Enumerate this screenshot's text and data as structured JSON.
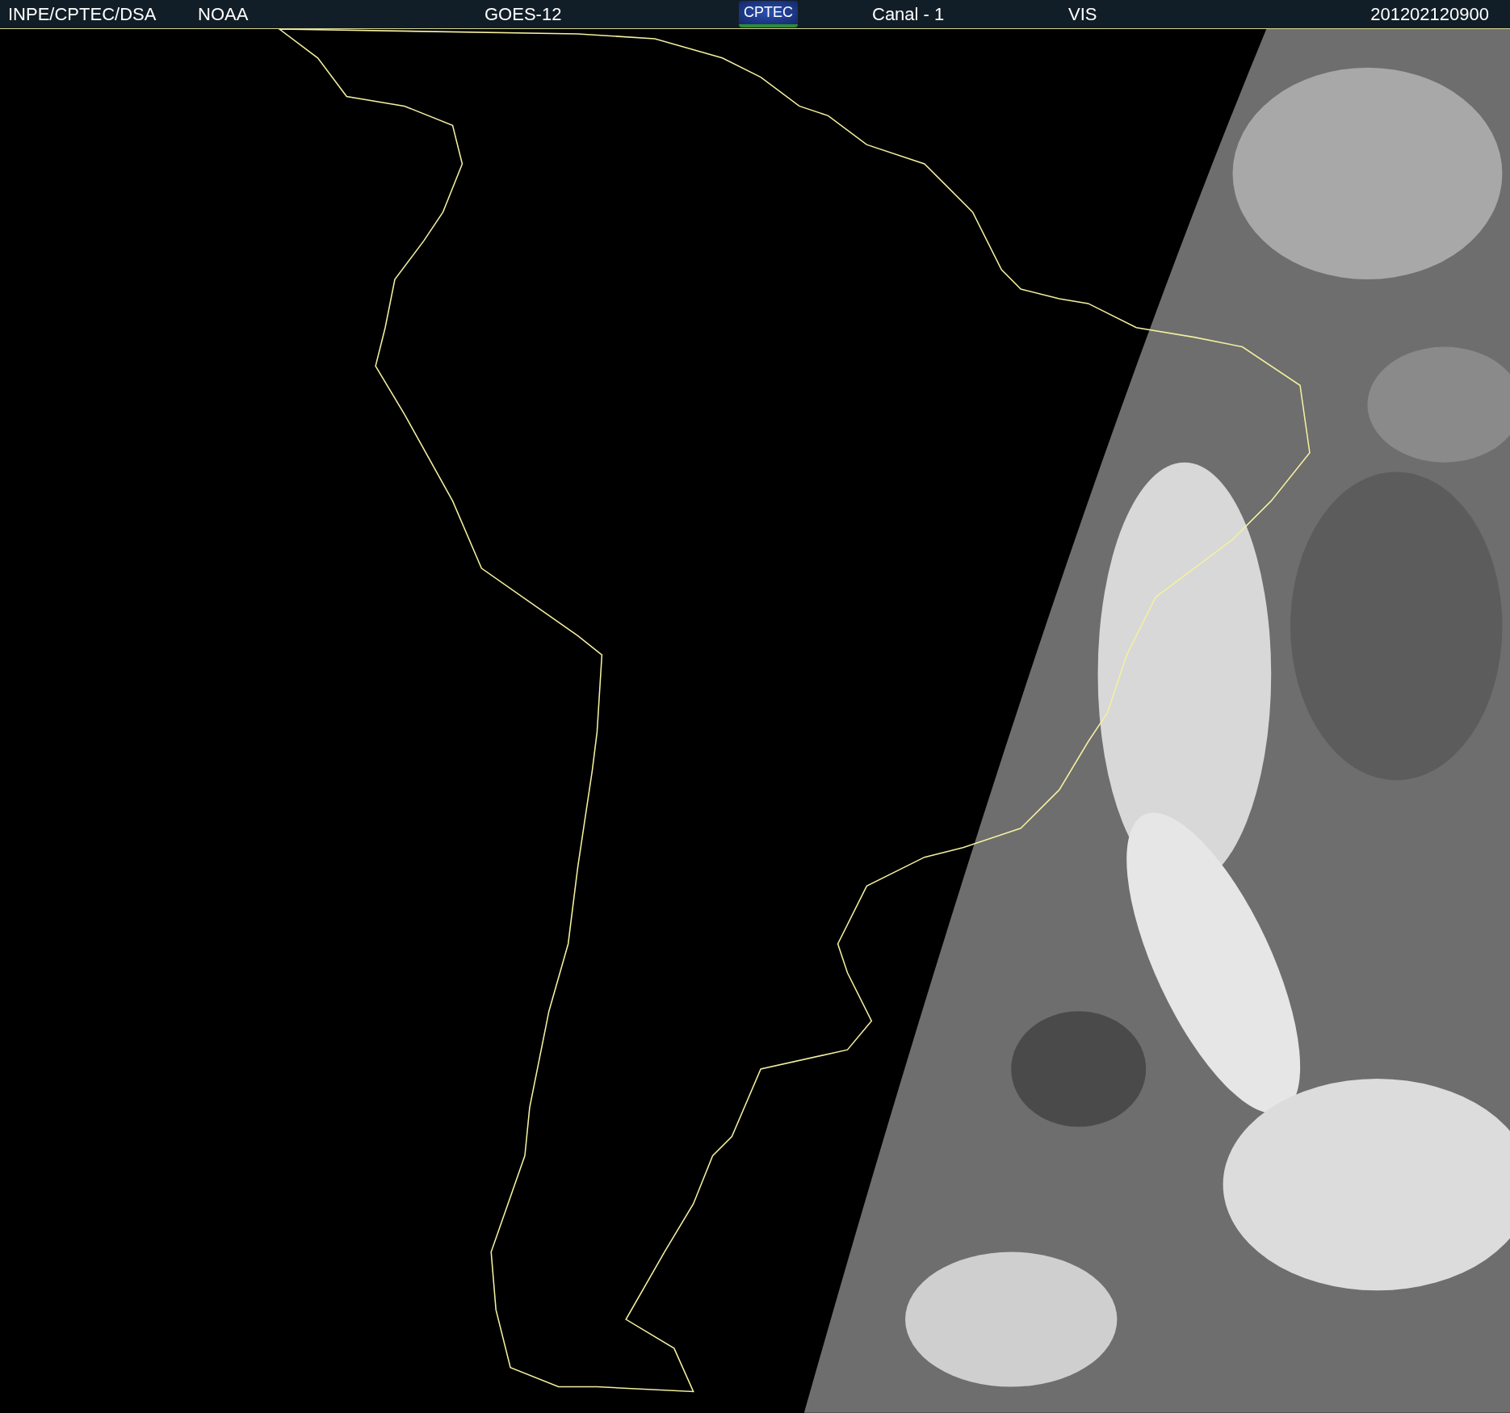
{
  "header": [
    {
      "kind": "text",
      "text": "INPE/CPTEC/DSA"
    },
    {
      "kind": "text",
      "text": "NOAA"
    },
    {
      "kind": "text",
      "text": "GOES-12"
    },
    {
      "kind": "logo",
      "text": "CPTEC"
    },
    {
      "kind": "text",
      "text": "Canal - 1"
    },
    {
      "kind": "text",
      "text": "VIS"
    },
    {
      "kind": "text",
      "text": "201202120900"
    }
  ]
}
